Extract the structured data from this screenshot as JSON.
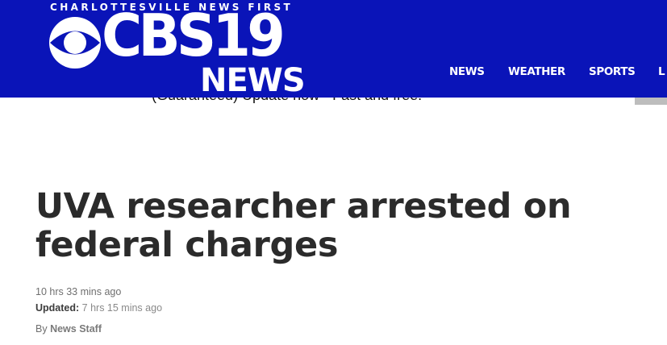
{
  "header": {
    "tagline": "CHARLOTTESVILLE NEWS FIRST",
    "logo_text": "CBS19",
    "logo_subtext": "NEWS",
    "background_color": "#0a14b8",
    "nav": [
      "NEWS",
      "WEATHER",
      "SPORTS",
      "L"
    ]
  },
  "banner": {
    "text": "(Guaranteed) Update now - Fast and free."
  },
  "article": {
    "headline": "UVA researcher arrested on federal charges",
    "published": "10 hrs 33 mins ago",
    "updated_label": "Updated:",
    "updated_value": "7 hrs 15 mins ago",
    "by_label": "By",
    "author": "News Staff"
  }
}
